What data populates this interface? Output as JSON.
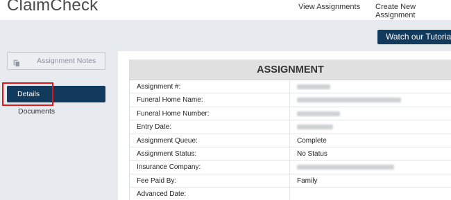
{
  "header": {
    "brand": "ClaimCheck",
    "nav": {
      "view_assignments": "View Assignments",
      "create_assignment": "Create New Assignment"
    },
    "tutorial_button": "Watch our Tutorial"
  },
  "sidebar": {
    "notes_button": "Assignment Notes",
    "items": [
      {
        "label": "Details",
        "active": true
      },
      {
        "label": "Documents",
        "active": false
      }
    ]
  },
  "assignment": {
    "title": "ASSIGNMENT",
    "rows": [
      {
        "label": "Assignment #:",
        "value": ""
      },
      {
        "label": "Funeral Home Name:",
        "value": ""
      },
      {
        "label": "Funeral Home Number:",
        "value": ""
      },
      {
        "label": "Entry Date:",
        "value": ""
      },
      {
        "label": "Assignment Queue:",
        "value": "Complete"
      },
      {
        "label": "Assignment Status:",
        "value": "No Status"
      },
      {
        "label": "Insurance Company:",
        "value": ""
      },
      {
        "label": "Fee Paid By:",
        "value": "Family"
      },
      {
        "label": "Advanced Date:",
        "value": ""
      }
    ]
  },
  "colors": {
    "primary": "#123a5c",
    "highlight": "#e0161a",
    "background": "#e7ebef"
  }
}
